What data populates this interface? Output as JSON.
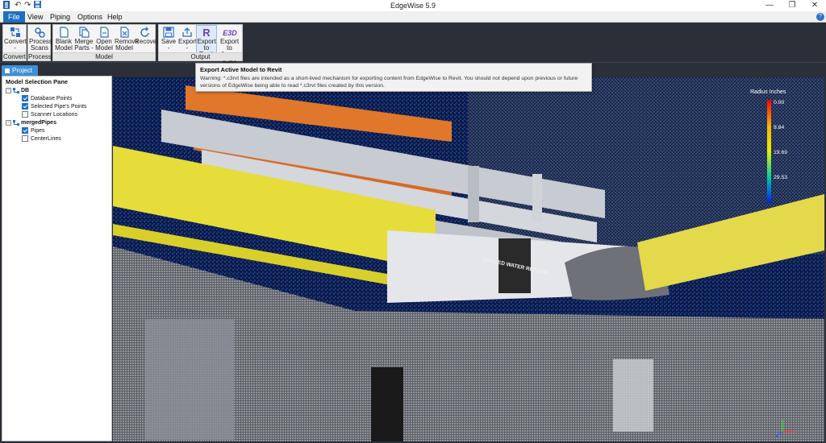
{
  "app": {
    "title": "EdgeWise 5.9",
    "quick_access": [
      "app-icon",
      "undo-icon",
      "redo-icon",
      "save-icon"
    ],
    "window_controls": [
      "minimize-icon",
      "restore-icon",
      "close-icon"
    ]
  },
  "menu": {
    "items": [
      {
        "label": "File",
        "active": true
      },
      {
        "label": "View"
      },
      {
        "label": "Piping"
      },
      {
        "label": "Options"
      },
      {
        "label": "Help"
      }
    ]
  },
  "ribbon": {
    "groups": [
      {
        "label": "Convert",
        "buttons": [
          {
            "label": "Convert",
            "sub": "-",
            "icon": "convert-icon"
          }
        ]
      },
      {
        "label": "Process",
        "buttons": [
          {
            "label": "Process",
            "sub": "Scans",
            "icon": "process-scans-icon"
          }
        ]
      },
      {
        "label": "Model",
        "buttons": [
          {
            "label": "Blank",
            "sub": "Model -",
            "icon": "blank-model-icon"
          },
          {
            "label": "Merge",
            "sub": "Parts -",
            "icon": "merge-parts-icon"
          },
          {
            "label": "Open",
            "sub": "Model",
            "icon": "open-model-icon"
          },
          {
            "label": "Remove",
            "sub": "Model",
            "icon": "remove-model-icon"
          },
          {
            "label": "Recover",
            "sub": "",
            "icon": "recover-icon"
          }
        ]
      },
      {
        "label": "Output",
        "buttons": [
          {
            "label": "Save",
            "sub": "-",
            "icon": "save-model-icon"
          },
          {
            "label": "Export",
            "sub": "-",
            "icon": "export-icon"
          },
          {
            "label": "Export",
            "sub": "to Revit",
            "icon": "revit-icon",
            "highlighted": true
          },
          {
            "label": "Export to",
            "sub": "Aveva E3D",
            "icon": "aveva-e3d-icon"
          }
        ]
      }
    ]
  },
  "tooltip": {
    "title": "Export Active Model to Revit",
    "body": "Warning:  *.c3rvt files are intended as a short-lived mechanism for exporting content from EdgeWise to Revit.  You should not depend upon previous or future versions of EdgeWise being able to read *.c3rvt files created by this version."
  },
  "tabs": {
    "project": "Project"
  },
  "model_pane": {
    "title": "Model Selection Pane",
    "nodes": [
      {
        "label": "DB",
        "children": [
          {
            "label": "Database Points",
            "checked": true
          },
          {
            "label": "Selected Pipe's Points",
            "checked": true
          },
          {
            "label": "Scanner Locations",
            "checked": false
          }
        ]
      },
      {
        "label": "mergedPipes",
        "children": [
          {
            "label": "Pipes",
            "checked": true
          },
          {
            "label": "CenterLines",
            "checked": false
          }
        ]
      }
    ]
  },
  "viewport": {
    "legend_title": "Radius Inches",
    "legend_ticks": [
      "0.00",
      "9.84",
      "19.69",
      "29.53"
    ],
    "pipe_marking": "CHILLED WATER RETURN",
    "colors": {
      "accent": "#1f6fc1",
      "pipe_yellow": "#e6dc3a",
      "pipe_orange": "#e0772a"
    }
  }
}
